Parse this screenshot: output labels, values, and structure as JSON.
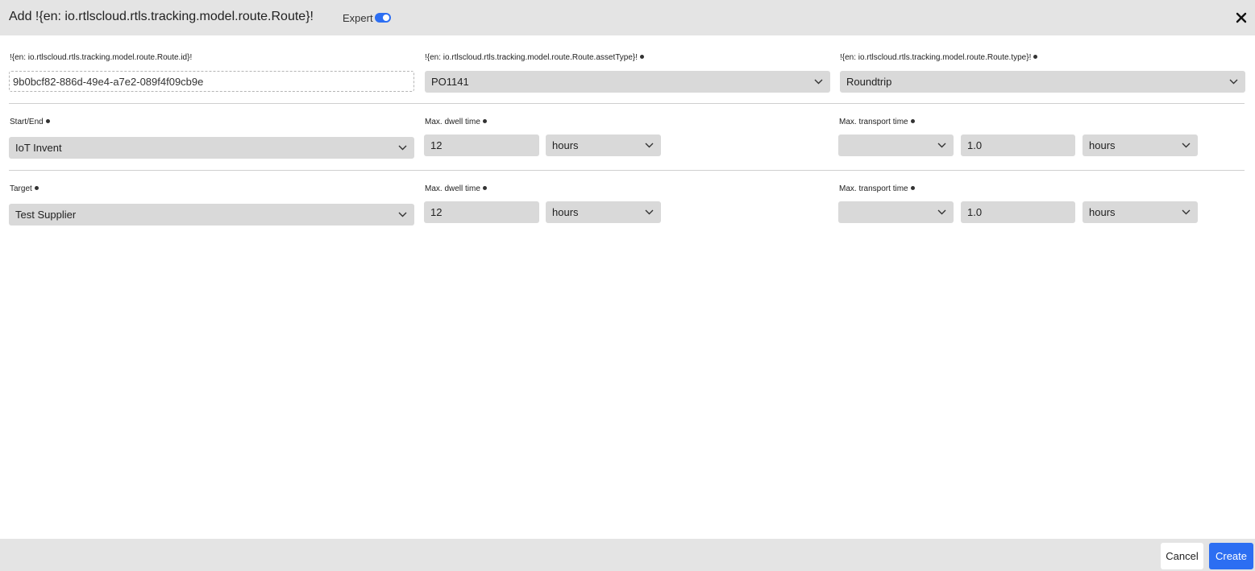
{
  "header": {
    "title": "Add !{en: io.rtlscloud.rtls.tracking.model.route.Route}!",
    "expert_label": "Expert",
    "expert_enabled": true,
    "close_icon": "close-icon"
  },
  "row1": {
    "id_label": "!{en: io.rtlscloud.rtls.tracking.model.route.Route.id}!",
    "id_value": "9b0bcf82-886d-49e4-a7e2-089f4f09cb9e",
    "asset_type_label": "!{en: io.rtlscloud.rtls.tracking.model.route.Route.assetType}!",
    "asset_type_value": "PO1141",
    "type_label": "!{en: io.rtlscloud.rtls.tracking.model.route.Route.type}!",
    "type_value": "Roundtrip"
  },
  "start": {
    "label": "Start/End",
    "value": "IoT Invent",
    "dwell_label": "Max. dwell time",
    "dwell_value": "12",
    "dwell_unit": "hours",
    "transport_label": "Max. transport time",
    "transport_select": "",
    "transport_value": "1.0",
    "transport_unit": "hours"
  },
  "target": {
    "label": "Target",
    "value": "Test Supplier",
    "dwell_label": "Max. dwell time",
    "dwell_value": "12",
    "dwell_unit": "hours",
    "transport_label": "Max. transport time",
    "transport_select": "",
    "transport_value": "1.0",
    "transport_unit": "hours"
  },
  "footer": {
    "cancel_label": "Cancel",
    "create_label": "Create"
  },
  "colors": {
    "accent": "#2c6ef2",
    "header_bg": "#e4e4e4",
    "field_bg": "#d9d9d9"
  }
}
